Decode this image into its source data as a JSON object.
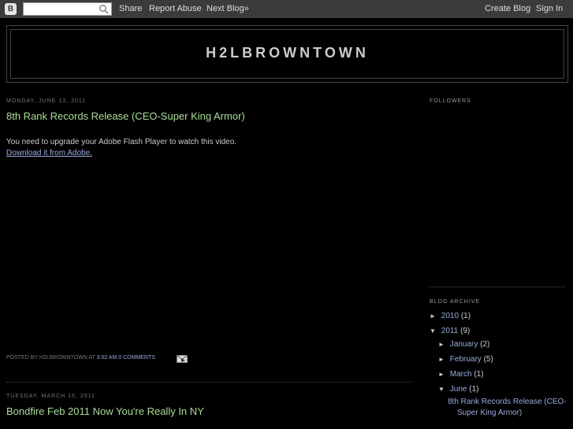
{
  "navbar": {
    "logo_icon": "blogger-icon",
    "search_placeholder": "",
    "share": "Share",
    "report_abuse": "Report Abuse",
    "next_blog": "Next Blog»",
    "create_blog": "Create Blog",
    "sign_in": "Sign In"
  },
  "header": {
    "title": "H2LBROWNTOWN"
  },
  "posts": [
    {
      "date": "MONDAY, JUNE 13, 2011",
      "title": "8th Rank Records Release (CEO-Super King Armor)",
      "flash_message": "You need to upgrade your Adobe Flash Player to watch this video.",
      "flash_link": "Download it from Adobe.",
      "footer": {
        "posted_by": "POSTED BY H2LBROWNTOWN AT",
        "time": "3:02 AM",
        "comments": "0 COMMENTS"
      }
    },
    {
      "date": "TUESDAY, MARCH 15, 2011",
      "title": "Bondfire Feb 2011 Now You're Really In NY"
    }
  ],
  "sidebar": {
    "followers_title": "FOLLOWERS",
    "archive_title": "BLOG ARCHIVE",
    "archive": {
      "y2010": {
        "toggle": "►",
        "label": "2010",
        "count": "(1)"
      },
      "y2011": {
        "toggle": "▼",
        "label": "2011",
        "count": "(9)"
      },
      "jan": {
        "toggle": "►",
        "label": "January",
        "count": "(2)"
      },
      "feb": {
        "toggle": "►",
        "label": "February",
        "count": "(5)"
      },
      "mar": {
        "toggle": "►",
        "label": "March",
        "count": "(1)"
      },
      "jun": {
        "toggle": "▼",
        "label": "June",
        "count": "(1)"
      },
      "post_line1": "8th Rank Records Release (CEO-",
      "post_line2": "Super King Armor)"
    }
  },
  "colors": {
    "background": "#000000",
    "navbar": "#3b3b3b",
    "title_green": "#aadd99",
    "link_blue": "#99aadd"
  }
}
